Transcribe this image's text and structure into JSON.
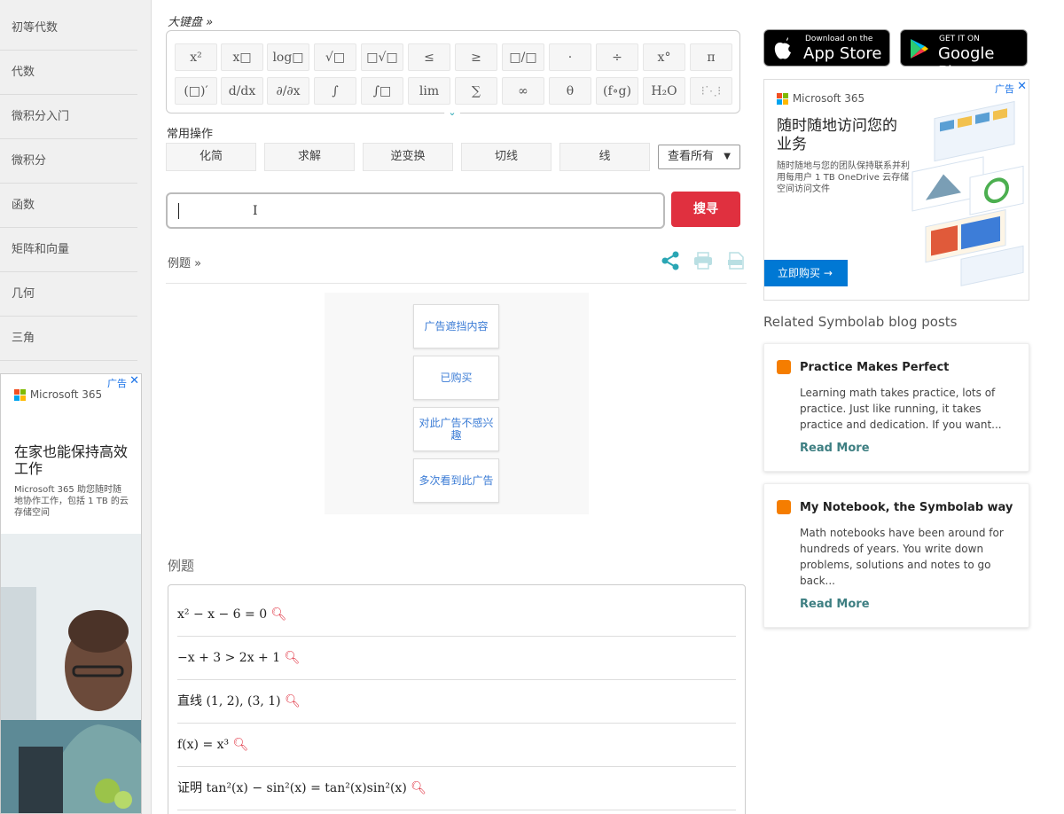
{
  "sidebar": {
    "items": [
      "初等代数",
      "代数",
      "微积分入门",
      "微积分",
      "函数",
      "矩阵和向量",
      "几何",
      "三角"
    ]
  },
  "side_ad": {
    "brand": "Microsoft 365",
    "ad_label": "广告",
    "headline": "在家也能保持高效工作",
    "body": "Microsoft 365 助您随时随地协作工作，包括 1 TB 的云存储空间"
  },
  "keyboard": {
    "title": "大键盘 »",
    "row1": [
      "x²",
      "x□",
      "log□",
      "√□",
      "□√□",
      "≤",
      "≥",
      "□/□",
      "·",
      "÷",
      "x°",
      "π"
    ],
    "row2": [
      "(□)′",
      "d/dx",
      "∂/∂x",
      "∫",
      "∫□",
      "lim",
      "∑",
      "∞",
      "θ",
      "(f∘g)",
      "H₂O",
      "⁝⋱⁝"
    ]
  },
  "operations": {
    "title": "常用操作",
    "buttons": [
      "化简",
      "求解",
      "逆变换",
      "切线",
      "线"
    ],
    "more": "查看所有"
  },
  "search": {
    "value": "",
    "button": "搜寻"
  },
  "examples_link": "例题 »",
  "ad_blocker": {
    "options": [
      "广告遮挡内容",
      "已购买",
      "对此广告不感兴趣",
      "多次看到此广告"
    ]
  },
  "examples": {
    "heading": "例题",
    "items": [
      "x² − x − 6 = 0",
      "−x + 3 > 2x + 1",
      "(1, 2), (3, 1)",
      "f(x) = x³",
      "tan²(x) − sin²(x) = tan²(x)sin²(x)"
    ],
    "prefixes": [
      "",
      "",
      "直线",
      "",
      "证明"
    ]
  },
  "stores": {
    "apple_small": "Download on the",
    "apple_big": "App Store",
    "google_small": "GET IT ON",
    "google_big": "Google Play"
  },
  "right_ad": {
    "brand": "Microsoft 365",
    "ad_label": "广告",
    "headline": "随时随地访问您的业务",
    "body": "随时随地与您的团队保持联系并利用每用户 1 TB OneDrive 云存储空间访问文件",
    "cta": "立即购买 →"
  },
  "related": {
    "heading": "Related Symbolab blog posts",
    "posts": [
      {
        "title": "Practice Makes Perfect",
        "text": "Learning math takes practice, lots of practice. Just like running, it takes practice and dedication. If you want...",
        "more": "Read More"
      },
      {
        "title": "My Notebook, the Symbolab way",
        "text": "Math notebooks have been around for hundreds of years. You write down problems, solutions and notes to go back...",
        "more": "Read More"
      }
    ]
  },
  "colors": {
    "accent": "#e0303f",
    "teal": "#2aa6b4",
    "search_icon": "#e0303f",
    "link": "#3e7f82"
  }
}
